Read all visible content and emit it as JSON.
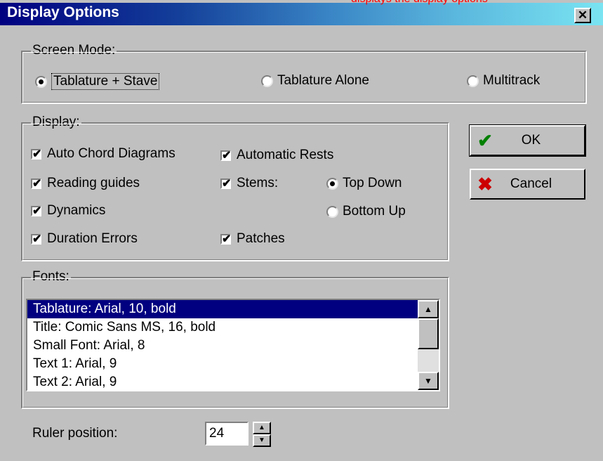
{
  "window": {
    "title": "Display Options",
    "overlay_text": "displays the display options",
    "close_glyph": "✕"
  },
  "screen_mode": {
    "legend": "Screen Mode:",
    "options": [
      {
        "label": "Tablature + Stave",
        "checked": true
      },
      {
        "label": "Tablature Alone",
        "checked": false
      },
      {
        "label": "Multitrack",
        "checked": false
      }
    ]
  },
  "display": {
    "legend": "Display:",
    "checkboxes": {
      "auto_chord_diagrams": {
        "label": "Auto Chord Diagrams",
        "checked": true
      },
      "reading_guides": {
        "label": "Reading guides",
        "checked": true
      },
      "dynamics": {
        "label": "Dynamics",
        "checked": true
      },
      "duration_errors": {
        "label": "Duration Errors",
        "checked": true
      },
      "automatic_rests": {
        "label": "Automatic Rests",
        "checked": true
      },
      "stems": {
        "label": "Stems:",
        "checked": true
      },
      "patches": {
        "label": "Patches",
        "checked": true
      }
    },
    "stem_direction": [
      {
        "label": "Top Down",
        "checked": true
      },
      {
        "label": "Bottom Up",
        "checked": false
      }
    ]
  },
  "fonts": {
    "legend": "Fonts:",
    "items": [
      "Tablature: Arial, 10, bold",
      "Title: Comic Sans MS, 16, bold",
      "Small Font: Arial, 8",
      "Text 1: Arial, 9",
      "Text 2: Arial, 9"
    ],
    "selected_index": 0
  },
  "ruler": {
    "label": "Ruler position:",
    "value": "24"
  },
  "buttons": {
    "ok": {
      "label": "OK",
      "icon": "checkmark-icon"
    },
    "cancel": {
      "label": "Cancel",
      "icon": "x-icon"
    }
  },
  "colors": {
    "title_bar_start": "#000080",
    "title_bar_end": "#7ae4f2",
    "selection": "#000080",
    "ok_icon": "#008000",
    "cancel_icon": "#cc0000"
  }
}
